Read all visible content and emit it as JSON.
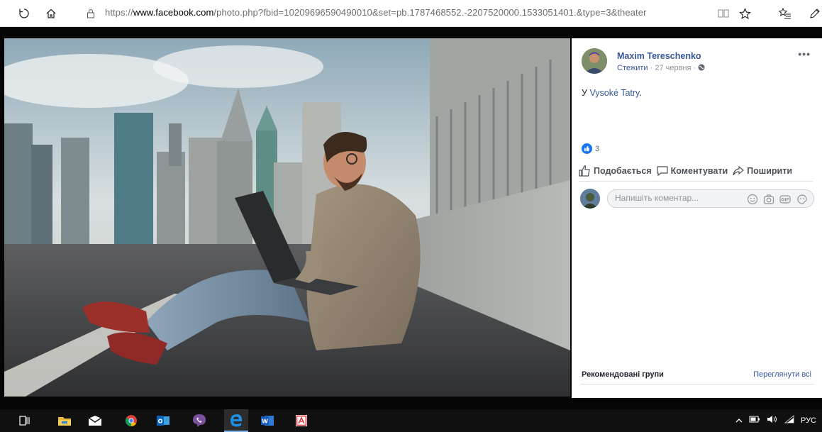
{
  "browser": {
    "address_prefix": "https://",
    "address_domain": "www.facebook.com",
    "address_path": "/photo.php?fbid=10209696590490010&set=pb.1787468552.-2207520000.1533051401.&type=3&theater",
    "icons": {
      "refresh": "refresh-icon",
      "home": "home-icon",
      "lock": "lock-icon",
      "reading_view": "reading-view-icon",
      "favorite": "star-icon",
      "favorites_list": "favorites-list-icon",
      "notes": "pen-icon"
    }
  },
  "post": {
    "author": "Maxim Tereschenko",
    "follow": "Стежити",
    "date": "27 червня",
    "separator": "·",
    "checkin_prefix": "У",
    "place": "Vysoké Tatry",
    "checkin_suffix": ".",
    "more": "•••",
    "likes_count": "3",
    "actions": {
      "like": "Подобається",
      "comment": "Коментувати",
      "share": "Поширити"
    },
    "comment_placeholder": "Напишіть коментар...",
    "comment_icons": [
      "emoji-icon",
      "camera-icon",
      "gif-icon",
      "sticker-icon"
    ]
  },
  "sidebar": {
    "groups_title": "Рекомендовані групи",
    "groups_link": "Переглянути всі"
  },
  "taskbar": {
    "apps": [
      "task-view-icon",
      "file-explorer-icon",
      "mail-icon",
      "chrome-icon",
      "outlook-icon",
      "viber-icon",
      "edge-icon",
      "word-icon",
      "pdf-icon"
    ],
    "language": "РУС"
  },
  "colors": {
    "facebook_blue": "#385898",
    "like_blue": "#1877f2",
    "taskbar": "#101010"
  }
}
